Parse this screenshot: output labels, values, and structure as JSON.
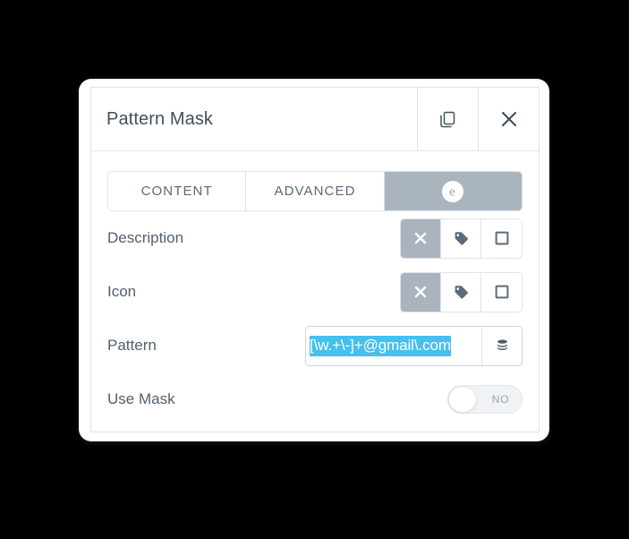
{
  "window": {
    "title": "Pattern Mask",
    "header_actions": [
      {
        "name": "duplicate",
        "icon": "copy-icon"
      },
      {
        "name": "close",
        "icon": "close-icon"
      }
    ]
  },
  "tabs": [
    {
      "label": "CONTENT",
      "active": false
    },
    {
      "label": "ADVANCED",
      "active": false
    },
    {
      "label": "",
      "icon": "elementor-logo-icon",
      "active": true
    }
  ],
  "fields": {
    "description": {
      "label": "Description",
      "options": [
        {
          "icon": "close-x-icon",
          "selected": true
        },
        {
          "icon": "tag-icon",
          "selected": false
        },
        {
          "icon": "square-icon",
          "selected": false
        }
      ]
    },
    "icon": {
      "label": "Icon",
      "options": [
        {
          "icon": "close-x-icon",
          "selected": true
        },
        {
          "icon": "tag-icon",
          "selected": false
        },
        {
          "icon": "square-icon",
          "selected": false
        }
      ]
    },
    "pattern": {
      "label": "Pattern",
      "value": "[\\w.+\\-]+@gmail\\.com",
      "placeholder": "",
      "selected_text": true,
      "addon_icon": "database-icon"
    },
    "use_mask": {
      "label": "Use Mask",
      "state_label": "NO",
      "on": false
    }
  },
  "colors": {
    "page_background": "#000000",
    "panel_background": "#ffffff",
    "border": "#dfe3e8",
    "text_primary": "#40505e",
    "text_secondary": "#59697a",
    "accent_selected": "#a9b4bf",
    "selection_highlight": "#45c0ef",
    "toggle_track": "#f0f2f4",
    "toggle_label": "#9aa7b4"
  }
}
